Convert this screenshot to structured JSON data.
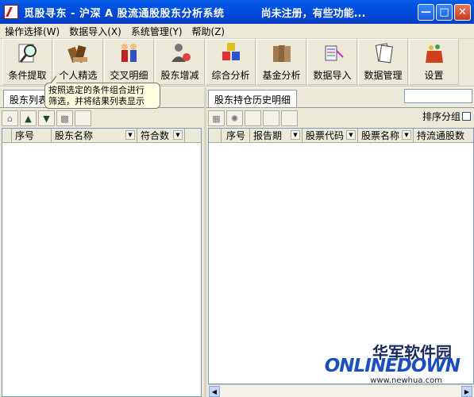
{
  "window": {
    "title": "觅股寻东 - 沪深 A 股流通股股东分析系统",
    "registration": "尚未注册，有些功能..."
  },
  "menu": [
    {
      "label": "操作选择(W)"
    },
    {
      "label": "数据导入(X)"
    },
    {
      "label": "系统管理(Y)"
    },
    {
      "label": "帮助(Z)"
    }
  ],
  "toolbar": [
    {
      "label": "条件提取",
      "icon": "search-icon"
    },
    {
      "label": "个人精选",
      "icon": "books-icon"
    },
    {
      "label": "交叉明细",
      "icon": "people-icon"
    },
    {
      "label": "股东增减",
      "icon": "user-change-icon"
    },
    {
      "label": "综合分析",
      "icon": "blocks-icon"
    },
    {
      "label": "基金分析",
      "icon": "folders-icon"
    },
    {
      "label": "数据导入",
      "icon": "import-icon"
    },
    {
      "label": "数据管理",
      "icon": "papers-icon"
    },
    {
      "label": "设置",
      "icon": "settings-bag-icon"
    }
  ],
  "tooltip": {
    "line1": "按照选定的条件组合进行",
    "line2": "筛选，并将结果列表显示"
  },
  "left": {
    "tab": "股东列表",
    "columns": [
      "序号",
      "股东名称",
      "符合数"
    ]
  },
  "right": {
    "tab": "股东持仓历史明细",
    "sort_label": "排序分组",
    "columns": [
      "序号",
      "报告期",
      "股票代码",
      "股票名称",
      "持流通股数"
    ]
  },
  "watermark": {
    "cn": "华军软件园",
    "logo": "ONLINEDOWN",
    "url": "www.newhua.com"
  },
  "colors": {
    "titlebar": "#0055e5",
    "chrome": "#ece9d8",
    "tooltip": "#ffffe1"
  }
}
